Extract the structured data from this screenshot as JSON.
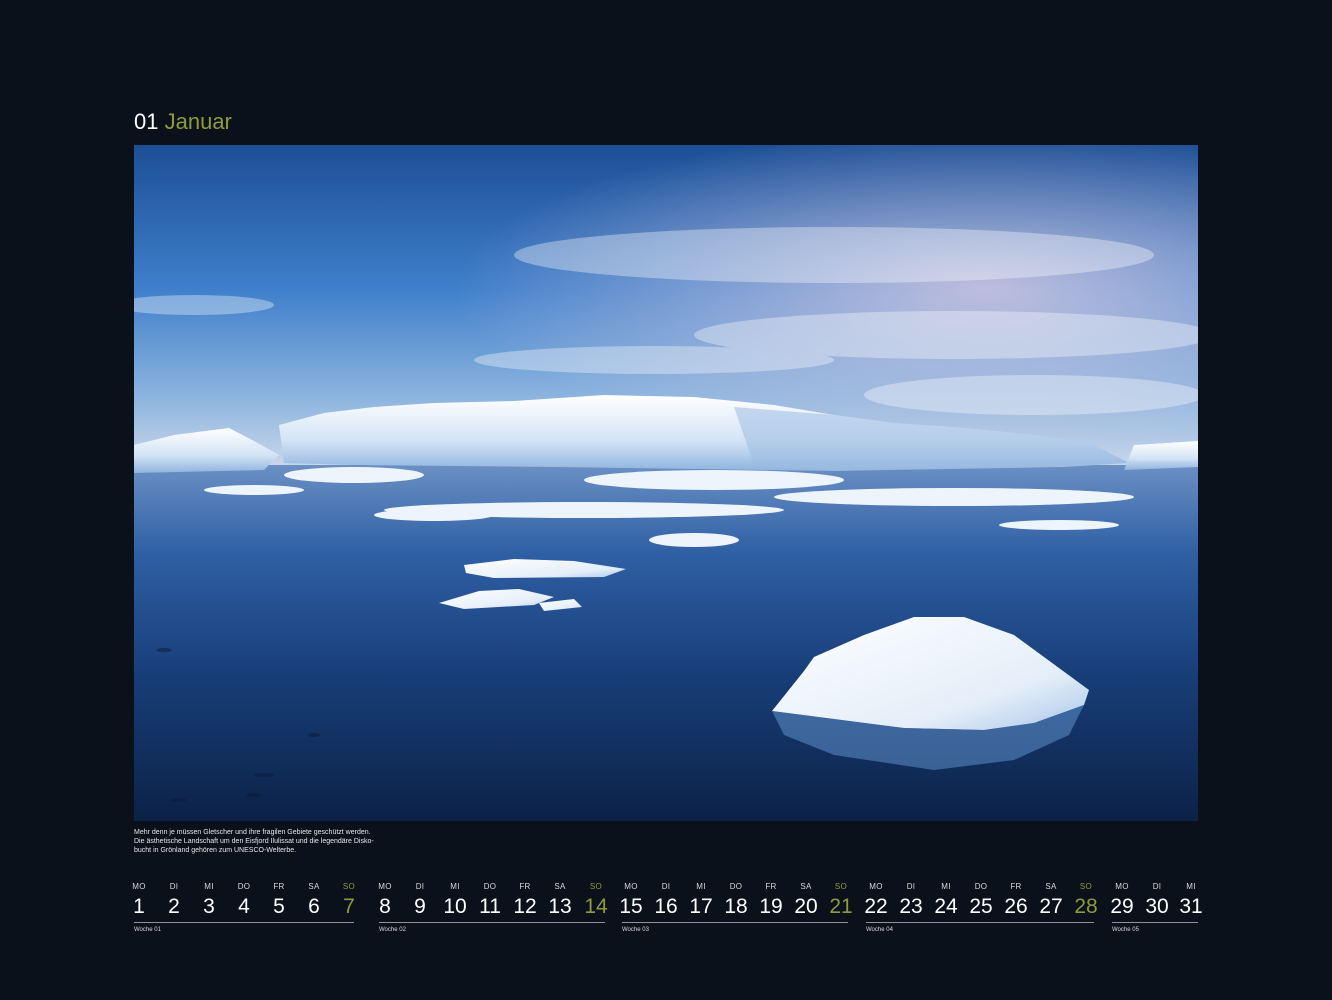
{
  "header": {
    "month_number": "01",
    "month_name": "Januar"
  },
  "photo": {
    "subject": "icebergs-in-ilulissat-icefjord"
  },
  "caption": {
    "lines": [
      "Mehr denn je müssen Gletscher und ihre fragilen Gebiete geschützt werden.",
      "Die ästhetische Landschaft um den Eisfjord Ilulissat und die legendäre Disko-",
      "bucht in Grönland gehören zum UNESCO-Welterbe."
    ]
  },
  "calendar": {
    "weeks": [
      {
        "label": "Woche 01",
        "days": [
          {
            "wd": "MO",
            "d": "1"
          },
          {
            "wd": "DI",
            "d": "2"
          },
          {
            "wd": "MI",
            "d": "3"
          },
          {
            "wd": "DO",
            "d": "4"
          },
          {
            "wd": "FR",
            "d": "5"
          },
          {
            "wd": "SA",
            "d": "6"
          },
          {
            "wd": "SO",
            "d": "7"
          }
        ]
      },
      {
        "label": "Woche 02",
        "days": [
          {
            "wd": "MO",
            "d": "8"
          },
          {
            "wd": "DI",
            "d": "9"
          },
          {
            "wd": "MI",
            "d": "10"
          },
          {
            "wd": "DO",
            "d": "11"
          },
          {
            "wd": "FR",
            "d": "12"
          },
          {
            "wd": "SA",
            "d": "13"
          },
          {
            "wd": "SO",
            "d": "14"
          }
        ]
      },
      {
        "label": "Woche 03",
        "days": [
          {
            "wd": "MO",
            "d": "15"
          },
          {
            "wd": "DI",
            "d": "16"
          },
          {
            "wd": "MI",
            "d": "17"
          },
          {
            "wd": "DO",
            "d": "18"
          },
          {
            "wd": "FR",
            "d": "19"
          },
          {
            "wd": "SA",
            "d": "20"
          },
          {
            "wd": "SO",
            "d": "21"
          }
        ]
      },
      {
        "label": "Woche 04",
        "days": [
          {
            "wd": "MO",
            "d": "22"
          },
          {
            "wd": "DI",
            "d": "23"
          },
          {
            "wd": "MI",
            "d": "24"
          },
          {
            "wd": "DO",
            "d": "25"
          },
          {
            "wd": "FR",
            "d": "26"
          },
          {
            "wd": "SA",
            "d": "27"
          },
          {
            "wd": "SO",
            "d": "28"
          }
        ]
      },
      {
        "label": "Woche 05",
        "days": [
          {
            "wd": "MO",
            "d": "29"
          },
          {
            "wd": "DI",
            "d": "30"
          },
          {
            "wd": "MI",
            "d": "31"
          }
        ]
      }
    ]
  },
  "colors": {
    "background": "#0b111b",
    "accent": "#8e9a3c",
    "text": "#ffffff"
  }
}
